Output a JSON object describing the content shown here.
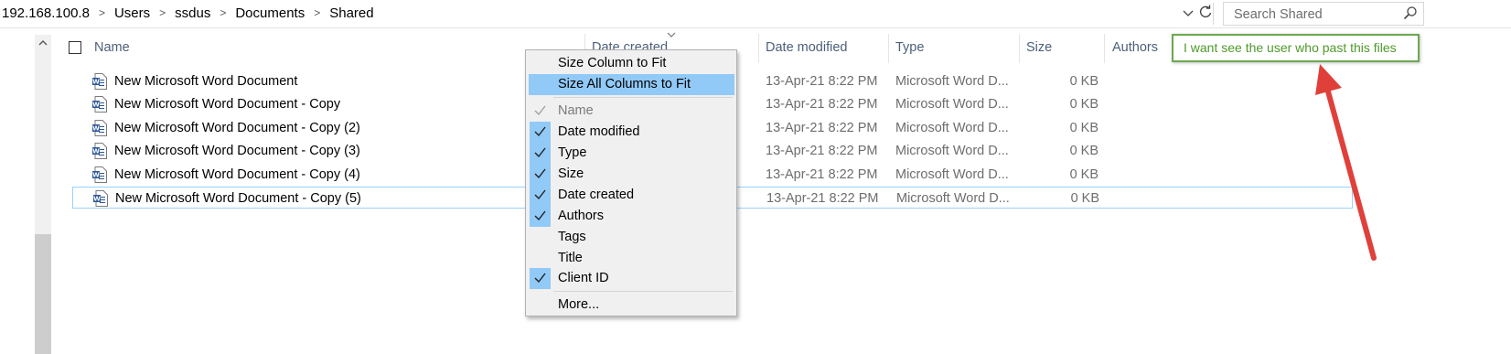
{
  "address_bar": {
    "crumbs": [
      "192.168.100.8",
      "Users",
      "ssdus",
      "Documents",
      "Shared"
    ],
    "separator": ">",
    "dropdown_icon": "chevron-down-icon",
    "refresh_icon": "refresh-icon"
  },
  "search": {
    "placeholder": "Search Shared",
    "icon": "search-icon"
  },
  "columns": {
    "name": "Name",
    "date_created": "Date created",
    "date_modified": "Date modified",
    "type": "Type",
    "size": "Size",
    "authors": "Authors"
  },
  "files": [
    {
      "name": "New Microsoft Word Document",
      "date_modified": "13-Apr-21 8:22 PM",
      "type": "Microsoft Word D...",
      "size": "0 KB"
    },
    {
      "name": "New Microsoft Word Document - Copy",
      "date_modified": "13-Apr-21 8:22 PM",
      "type": "Microsoft Word D...",
      "size": "0 KB"
    },
    {
      "name": "New Microsoft Word Document - Copy (2)",
      "date_modified": "13-Apr-21 8:22 PM",
      "type": "Microsoft Word D...",
      "size": "0 KB"
    },
    {
      "name": "New Microsoft Word Document - Copy (3)",
      "date_modified": "13-Apr-21 8:22 PM",
      "type": "Microsoft Word D...",
      "size": "0 KB"
    },
    {
      "name": "New Microsoft Word Document - Copy (4)",
      "date_modified": "13-Apr-21 8:22 PM",
      "type": "Microsoft Word D...",
      "size": "0 KB"
    },
    {
      "name": "New Microsoft Word Document - Copy (5)",
      "date_modified": "13-Apr-21 8:22 PM",
      "type": "Microsoft Word D...",
      "size": "0 KB"
    }
  ],
  "context_menu": {
    "size_column": "Size Column to Fit",
    "size_all": "Size All Columns to Fit",
    "items": [
      {
        "label": "Name",
        "checked": true,
        "disabled": true
      },
      {
        "label": "Date modified",
        "checked": true
      },
      {
        "label": "Type",
        "checked": true
      },
      {
        "label": "Size",
        "checked": true
      },
      {
        "label": "Date created",
        "checked": true
      },
      {
        "label": "Authors",
        "checked": true
      },
      {
        "label": "Tags",
        "checked": false
      },
      {
        "label": "Title",
        "checked": false
      },
      {
        "label": "Client ID",
        "checked": true
      }
    ],
    "more": "More..."
  },
  "annotation": {
    "text": "I want see the user who past this files",
    "border_color": "#6aa84f",
    "text_color": "#4e9a2a",
    "arrow_color": "#e0403a"
  },
  "colors": {
    "header_text": "#4c607a",
    "selection_border": "#99d1ff",
    "menu_highlight": "#91c9f7",
    "word_icon_blue": "#2b5797"
  }
}
